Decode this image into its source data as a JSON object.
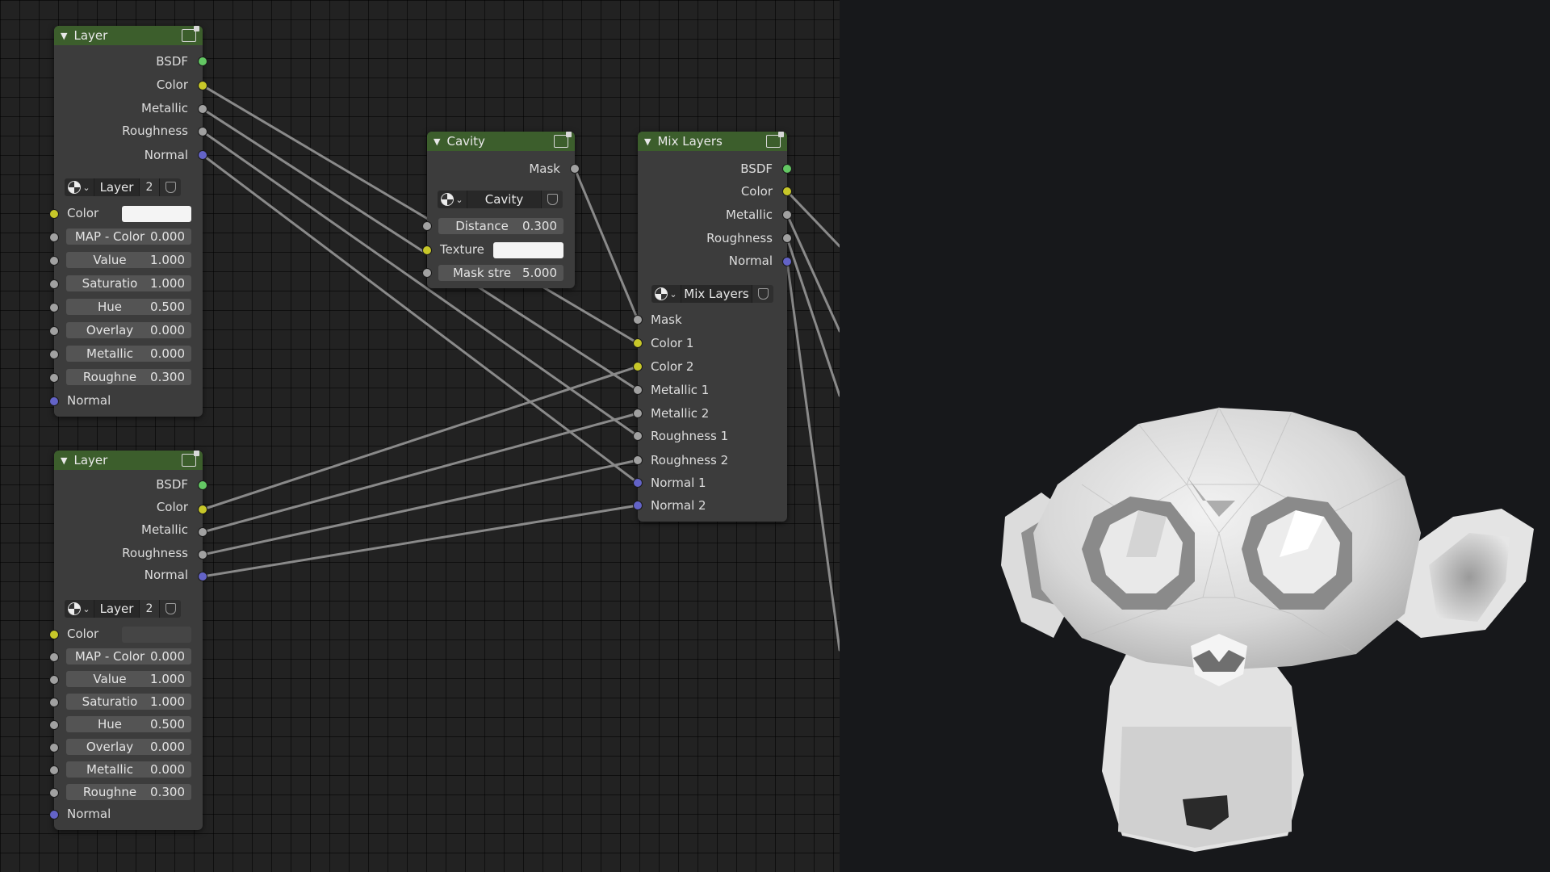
{
  "layer_node_1": {
    "title": "Layer",
    "outputs": [
      "BSDF",
      "Color",
      "Metallic",
      "Roughness",
      "Normal"
    ],
    "datablock": {
      "name": "Layer",
      "users": "2"
    },
    "color_label": "Color",
    "fields": [
      {
        "label": "MAP - Color",
        "value": "0.000"
      },
      {
        "label": "Value",
        "value": "1.000"
      },
      {
        "label": "Saturatio",
        "value": "1.000"
      },
      {
        "label": "Hue",
        "value": "0.500"
      },
      {
        "label": "Overlay",
        "value": "0.000"
      },
      {
        "label": "Metallic",
        "value": "0.000"
      },
      {
        "label": "Roughne",
        "value": "0.300"
      }
    ],
    "normal_label": "Normal",
    "swatch_color": "#f4f4f4"
  },
  "layer_node_2": {
    "title": "Layer",
    "outputs": [
      "BSDF",
      "Color",
      "Metallic",
      "Roughness",
      "Normal"
    ],
    "datablock": {
      "name": "Layer",
      "users": "2"
    },
    "color_label": "Color",
    "fields": [
      {
        "label": "MAP - Color",
        "value": "0.000"
      },
      {
        "label": "Value",
        "value": "1.000"
      },
      {
        "label": "Saturatio",
        "value": "1.000"
      },
      {
        "label": "Hue",
        "value": "0.500"
      },
      {
        "label": "Overlay",
        "value": "0.000"
      },
      {
        "label": "Metallic",
        "value": "0.000"
      },
      {
        "label": "Roughne",
        "value": "0.300"
      }
    ],
    "normal_label": "Normal",
    "swatch_color": "#454545"
  },
  "cavity_node": {
    "title": "Cavity",
    "output": "Mask",
    "datablock": {
      "name": "Cavity"
    },
    "distance": {
      "label": "Distance",
      "value": "0.300"
    },
    "texture_label": "Texture",
    "mask_strength": {
      "label": "Mask stre",
      "value": "5.000"
    }
  },
  "mix_layers_node": {
    "title": "Mix Layers",
    "outputs": [
      "BSDF",
      "Color",
      "Metallic",
      "Roughness",
      "Normal"
    ],
    "datablock": {
      "name": "Mix Layers"
    },
    "inputs": [
      "Mask",
      "Color 1",
      "Color 2",
      "Metallic 1",
      "Metallic 2",
      "Roughness 1",
      "Roughness 2",
      "Normal 1",
      "Normal 2"
    ]
  },
  "colors": {
    "node_header": "#3c5e2c",
    "node_body": "#3c3c3c",
    "socket_shader": "#63c763",
    "socket_color": "#c7c729",
    "socket_value": "#a1a1a1",
    "socket_vector": "#6363c7",
    "wire": "#8a8a8a",
    "viewport_bg": "#17181b"
  },
  "viewport": {
    "object": "Suzanne monkey head, low-poly, white cavity-shaded"
  }
}
